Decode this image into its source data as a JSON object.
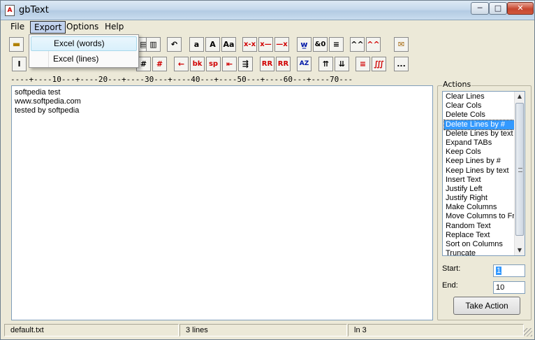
{
  "window": {
    "title": "gbText",
    "min_glyph": "─",
    "max_glyph": "□",
    "close_glyph": "✕"
  },
  "menu": {
    "file": "File",
    "export": "Export",
    "options": "Options",
    "help": "Help"
  },
  "export_menu": [
    "Excel (words)",
    "Excel (lines)"
  ],
  "toolbar1": [
    "a",
    "A",
    "Aa",
    "x-x",
    "x—",
    "—x",
    "w̲",
    "&0",
    "≡",
    "^^",
    "^^",
    "✉"
  ],
  "toolbar2": [
    "I",
    "#",
    "#",
    "←",
    "bk",
    "sp",
    "⇤",
    "⇶",
    "RR",
    "RR",
    "AZ",
    "⇈",
    "⇊",
    "≡",
    "∭",
    "..."
  ],
  "ruler": "----+----10---+----20---+----30---+----40---+----50---+----60---+----70---",
  "editor": {
    "lines": [
      "softpedia test",
      "www.softpedia.com",
      "tested by softpedia"
    ]
  },
  "actions": {
    "label": "Actions",
    "items": [
      "Clear Lines",
      "Clear Cols",
      "Delete Cols",
      "Delete Lines by #",
      "Delete Lines by text",
      "Expand TABs",
      "Keep Cols",
      "Keep Lines by #",
      "Keep Lines by text",
      "Insert Text",
      "Justify Left",
      "Justify Right",
      "Make Columns",
      "Move Columns to Front",
      "Random Text",
      "Replace Text",
      "Sort on Columns",
      "Truncate"
    ],
    "selected": "Delete Lines by #",
    "start_label": "Start:",
    "start_value": "1",
    "end_label": "End:",
    "end_value": "10",
    "button": "Take Action"
  },
  "status": {
    "file": "default.txt",
    "lines": "3 lines",
    "line_no": "ln 3"
  },
  "colors": {
    "accent_red": "#d00000",
    "selection_blue": "#3399ff"
  }
}
